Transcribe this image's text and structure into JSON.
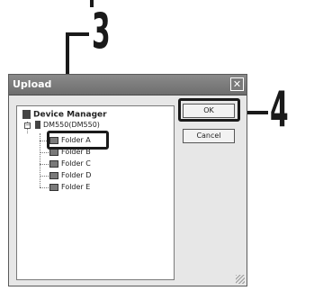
{
  "callouts": {
    "step_3": "3",
    "step_4": "4"
  },
  "dialog": {
    "title": "Upload",
    "close_glyph": "✕"
  },
  "tree": {
    "root_label": "Device Manager",
    "device_label": "DM550(DM550)",
    "folders": [
      "Folder A",
      "Folder B",
      "Folder C",
      "Folder D",
      "Folder E"
    ]
  },
  "buttons": {
    "ok_label": "OK",
    "cancel_label": "Cancel"
  }
}
